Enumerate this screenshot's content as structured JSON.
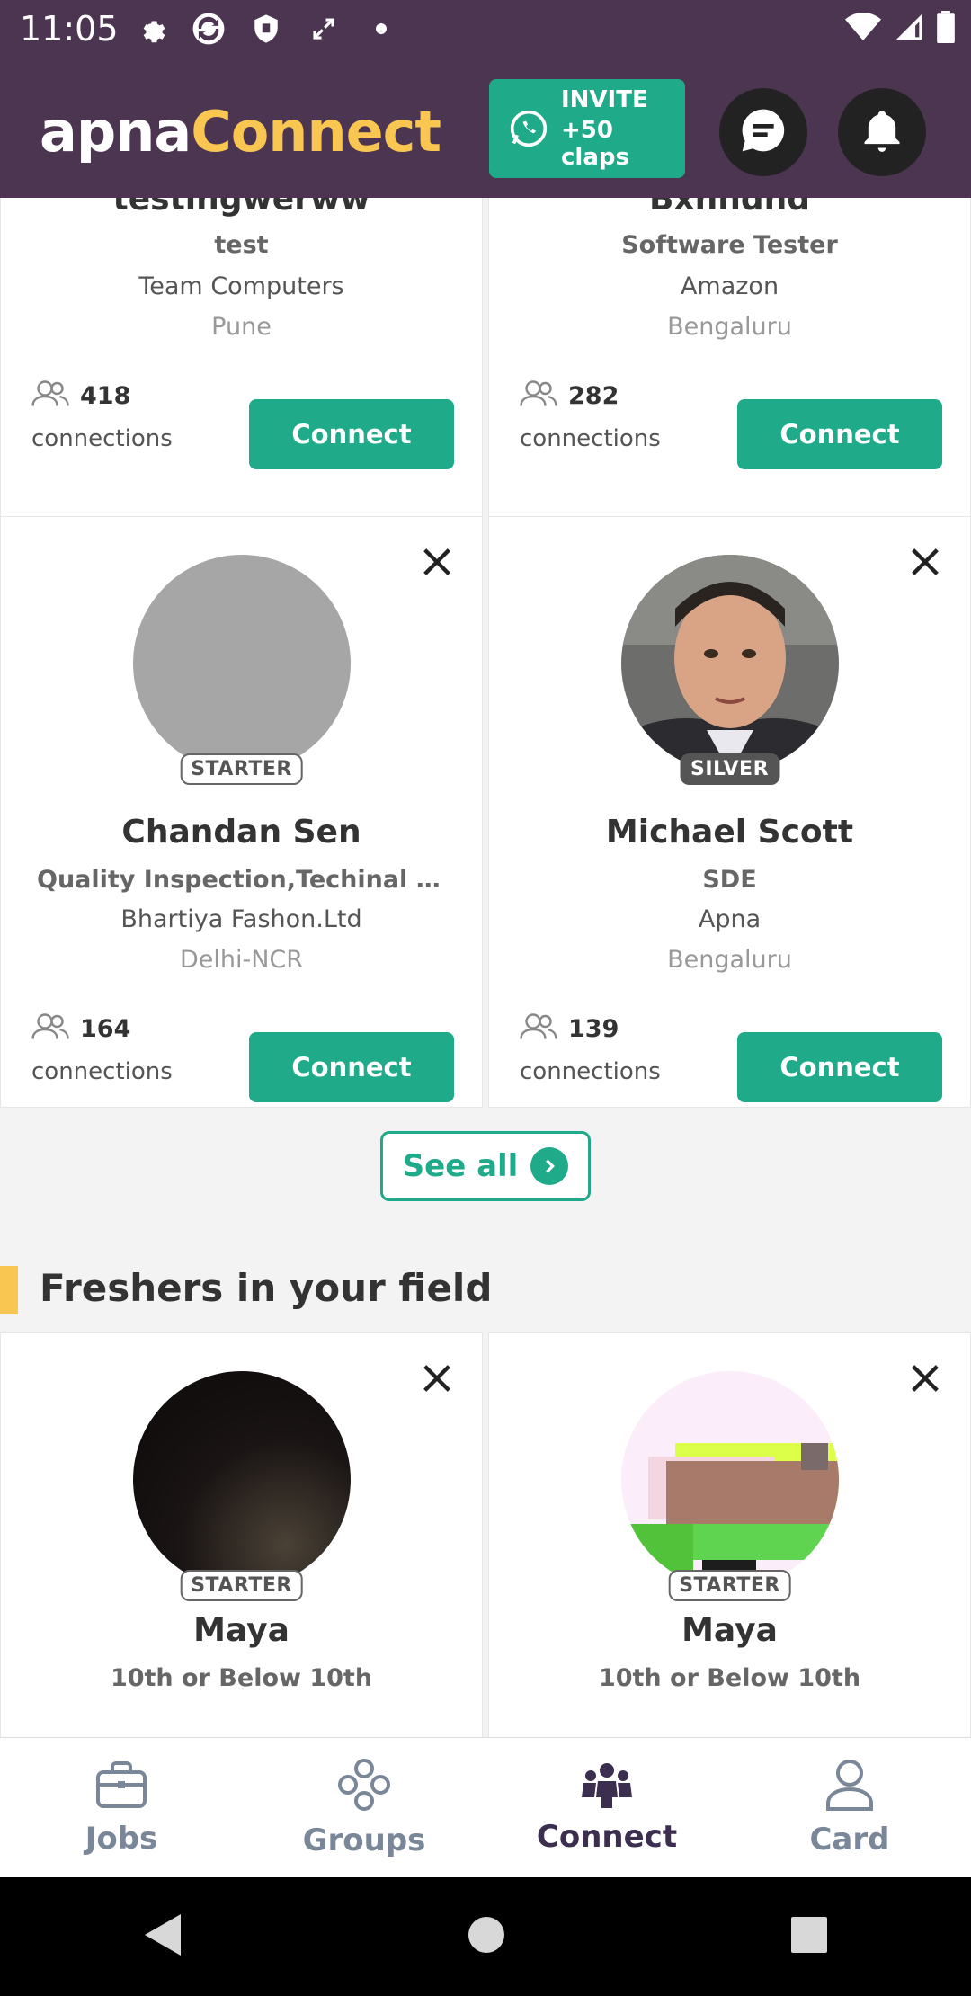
{
  "status_bar": {
    "time": "11:05"
  },
  "header": {
    "logo_apna": "apna",
    "logo_connect": "Connect",
    "invite_line1": "INVITE",
    "invite_line2": "+50 claps"
  },
  "cards": [
    {
      "name": "testingwerww",
      "role": "test",
      "company": "Team Computers",
      "city": "Pune",
      "connections": "418",
      "connections_label": "connections",
      "button": "Connect"
    },
    {
      "name": "Bxnndnd",
      "role": "Software Tester",
      "company": "Amazon",
      "city": "Bengaluru",
      "connections": "282",
      "connections_label": "connections",
      "button": "Connect"
    },
    {
      "name": "Chandan Sen",
      "role": "Quality Inspection,Techinal QA ...",
      "company": "Bhartiya Fashon.Ltd",
      "city": "Delhi-NCR",
      "badge": "STARTER",
      "connections": "164",
      "connections_label": "connections",
      "button": "Connect"
    },
    {
      "name": "Michael Scott",
      "role": "SDE",
      "company": "Apna",
      "city": "Bengaluru",
      "badge": "SILVER",
      "connections": "139",
      "connections_label": "connections",
      "button": "Connect"
    }
  ],
  "see_all": "See all",
  "freshers": {
    "title": "Freshers in your field",
    "cards": [
      {
        "name": "Maya",
        "role": "10th or Below 10th",
        "badge": "STARTER"
      },
      {
        "name": "Maya",
        "role": "10th or Below 10th",
        "badge": "STARTER"
      }
    ]
  },
  "bottom_nav": [
    {
      "label": "Jobs"
    },
    {
      "label": "Groups"
    },
    {
      "label": "Connect",
      "active": true
    },
    {
      "label": "Card"
    }
  ],
  "colors": {
    "header_bg": "#4b3550",
    "accent_green": "#1fab89",
    "accent_yellow": "#f9c652"
  }
}
